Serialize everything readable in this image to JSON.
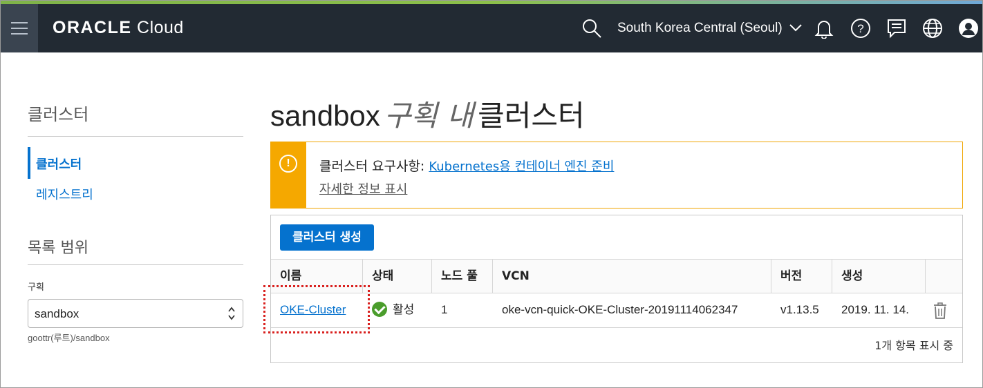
{
  "header": {
    "logo_brand": "ORACLE",
    "logo_product": "Cloud",
    "region": "South Korea Central (Seoul)",
    "icons": [
      "menu-icon",
      "search-icon",
      "chevron-down-icon",
      "bell-icon",
      "help-icon",
      "chat-icon",
      "globe-icon",
      "user-icon"
    ]
  },
  "sidebar": {
    "title": "클러스터",
    "nav": [
      {
        "label": "클러스터",
        "active": true
      },
      {
        "label": "레지스트리",
        "active": false
      }
    ],
    "scope": {
      "title": "목록 범위",
      "compartment_label": "구획",
      "compartment_value": "sandbox",
      "compartment_path": "goottr(루트)/sandbox"
    }
  },
  "main": {
    "title_compartment": "sandbox",
    "title_in": "구획 내",
    "title_resource": "클러스터",
    "alert": {
      "prefix": "클러스터 요구사항:",
      "link": "Kubernetes용 컨테이너 엔진 준비",
      "details": "자세한 정보 표시",
      "color": "#f5a800"
    },
    "create_button": "클러스터 생성",
    "table": {
      "columns": [
        "이름",
        "상태",
        "노드 풀",
        "VCN",
        "버전",
        "생성"
      ],
      "rows": [
        {
          "name": "OKE-Cluster",
          "status": "활성",
          "node_pools": "1",
          "vcn": "oke-vcn-quick-OKE-Cluster-20191114062347",
          "version": "v1.13.5",
          "created": "2019. 11. 14."
        }
      ]
    },
    "item_count": "1개 항목 표시 중"
  }
}
